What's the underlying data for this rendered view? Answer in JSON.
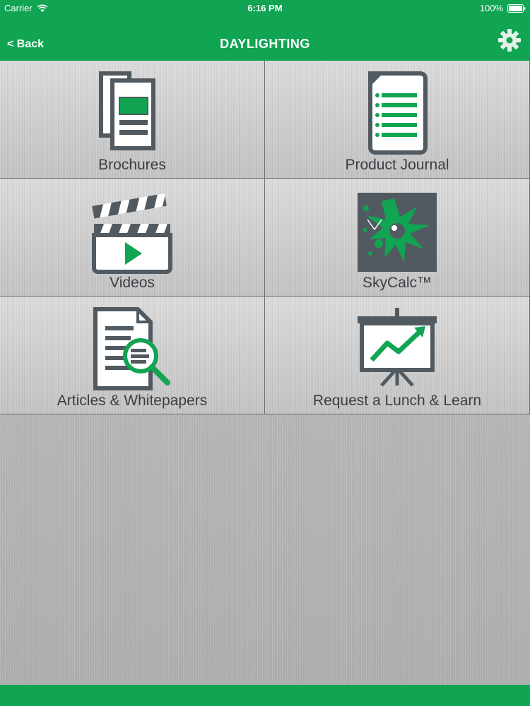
{
  "status_bar": {
    "carrier": "Carrier",
    "time": "6:16 PM",
    "battery": "100%"
  },
  "nav": {
    "back_label": "< Back",
    "title": "DAYLIGHTING"
  },
  "tiles": [
    {
      "label": "Brochures",
      "icon": "brochure-icon"
    },
    {
      "label": "Product Journal",
      "icon": "document-list-icon"
    },
    {
      "label": "Videos",
      "icon": "clapperboard-icon"
    },
    {
      "label": "SkyCalc™",
      "icon": "skycalc-logo-icon"
    },
    {
      "label": "Articles & Whitepapers",
      "icon": "document-search-icon"
    },
    {
      "label": "Request a Lunch & Learn",
      "icon": "presentation-chart-icon"
    }
  ],
  "colors": {
    "accent": "#10a453",
    "icon_gray": "#525a61",
    "icon_green": "#10a453"
  }
}
